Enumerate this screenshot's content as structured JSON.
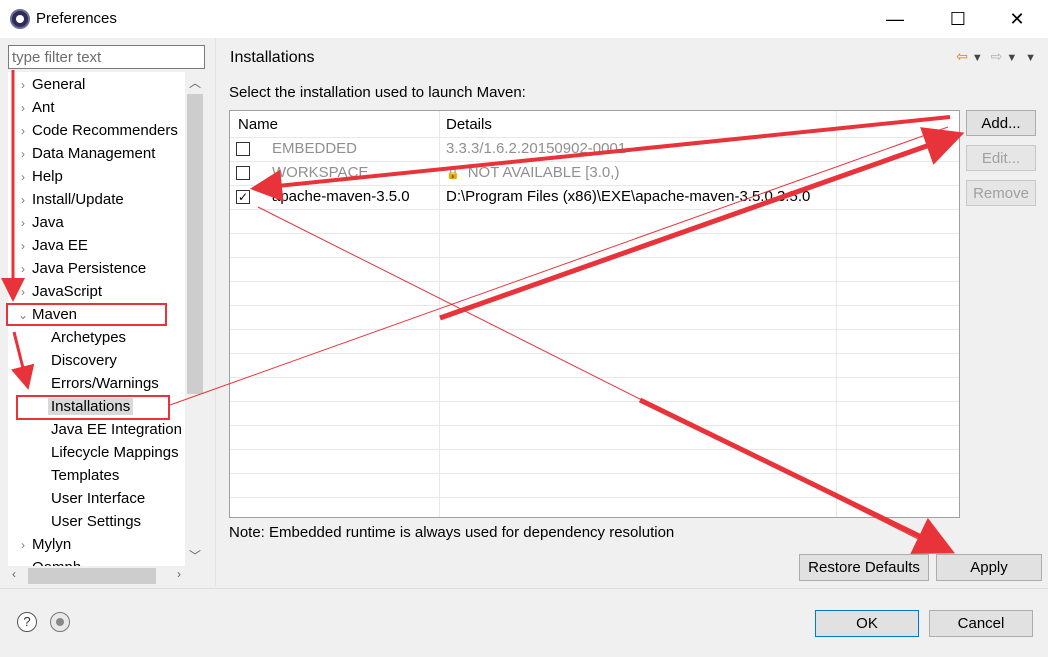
{
  "window": {
    "title": "Preferences",
    "minimize": "—",
    "maximize": "☐",
    "close": "✕"
  },
  "nav": {
    "filter_placeholder": "type filter text",
    "items": [
      {
        "label": "General",
        "expanded": false,
        "level": 0
      },
      {
        "label": "Ant",
        "expanded": false,
        "level": 0
      },
      {
        "label": "Code Recommenders",
        "expanded": false,
        "level": 0
      },
      {
        "label": "Data Management",
        "expanded": false,
        "level": 0
      },
      {
        "label": "Help",
        "expanded": false,
        "level": 0
      },
      {
        "label": "Install/Update",
        "expanded": false,
        "level": 0
      },
      {
        "label": "Java",
        "expanded": false,
        "level": 0
      },
      {
        "label": "Java EE",
        "expanded": false,
        "level": 0
      },
      {
        "label": "Java Persistence",
        "expanded": false,
        "level": 0
      },
      {
        "label": "JavaScript",
        "expanded": false,
        "level": 0
      },
      {
        "label": "Maven",
        "expanded": true,
        "level": 0
      },
      {
        "label": "Archetypes",
        "level": 1
      },
      {
        "label": "Discovery",
        "level": 1
      },
      {
        "label": "Errors/Warnings",
        "level": 1
      },
      {
        "label": "Installations",
        "level": 1,
        "selected": true
      },
      {
        "label": "Java EE Integration",
        "level": 1
      },
      {
        "label": "Lifecycle Mappings",
        "level": 1
      },
      {
        "label": "Templates",
        "level": 1
      },
      {
        "label": "User Interface",
        "level": 1
      },
      {
        "label": "User Settings",
        "level": 1
      },
      {
        "label": "Mylyn",
        "expanded": false,
        "level": 0
      },
      {
        "label": "Oomph",
        "expanded": false,
        "level": 0
      }
    ]
  },
  "page": {
    "title": "Installations",
    "description": "Select the installation used to launch Maven:",
    "note": "Note: Embedded runtime is always used for dependency resolution"
  },
  "table": {
    "columns": [
      "Name",
      "Details"
    ],
    "rows": [
      {
        "name": "EMBEDDED",
        "details": "3.3.3/1.6.2.20150902-0001",
        "checked": false,
        "disabled": true,
        "warning": false
      },
      {
        "name": "WORKSPACE",
        "details": "NOT AVAILABLE [3.0,)",
        "checked": false,
        "disabled": true,
        "warning": true
      },
      {
        "name": "apache-maven-3.5.0",
        "details": "D:\\Program Files (x86)\\EXE\\apache-maven-3.5.0 3.5.0",
        "checked": true,
        "disabled": false,
        "warning": false
      }
    ]
  },
  "side_buttons": {
    "add": "Add...",
    "edit": "Edit...",
    "remove": "Remove"
  },
  "buttons": {
    "restore_defaults": "Restore Defaults",
    "apply": "Apply",
    "ok": "OK",
    "cancel": "Cancel"
  },
  "colors": {
    "annotation": "#e8333a",
    "accent": "#0078d7"
  }
}
